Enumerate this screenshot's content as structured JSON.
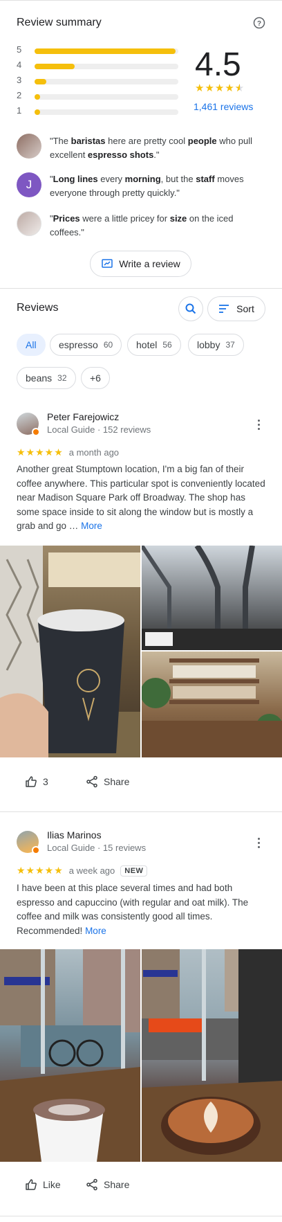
{
  "summary": {
    "title": "Review summary",
    "rating": "4.5",
    "reviews_link": "1,461 reviews",
    "histogram": [
      {
        "star": "5",
        "fraction": 0.98
      },
      {
        "star": "4",
        "fraction": 0.28
      },
      {
        "star": "3",
        "fraction": 0.08
      },
      {
        "star": "2",
        "fraction": 0.03
      },
      {
        "star": "1",
        "fraction": 0.04
      }
    ],
    "stars_filled": 4.5,
    "write_review_label": "Write a review"
  },
  "snippets": [
    {
      "html": "\"The <b>baristas</b> here are pretty cool <b>people</b> who pull excellent <b>espresso shots</b>.\""
    },
    {
      "avatar_letter": "J",
      "html": "\"<b>Long lines</b> every <b>morning</b>, but the <b>staff</b> moves everyone through pretty quickly.\""
    },
    {
      "html": "\"<b>Prices</b> were a little pricey for <b>size</b> on the iced coffees.\""
    }
  ],
  "reviews_section": {
    "title": "Reviews",
    "sort_label": "Sort",
    "chips": [
      {
        "label": "All",
        "count": ""
      },
      {
        "label": "espresso",
        "count": "60"
      },
      {
        "label": "hotel",
        "count": "56"
      },
      {
        "label": "lobby",
        "count": "37"
      },
      {
        "label": "beans",
        "count": "32"
      },
      {
        "label": "+6",
        "count": ""
      }
    ]
  },
  "reviews": [
    {
      "name": "Peter Farejowicz",
      "meta": "Local Guide · 152 reviews",
      "stars": "★★★★★",
      "time": "a month ago",
      "text": "Another great Stumptown location, I'm a big fan of their coffee anywhere. This particular spot is conveniently located near Madison Square Park off Broadway. The shop has some space inside to sit along the window but is mostly a grab and go … ",
      "more": "More",
      "likes": "3",
      "share": "Share"
    },
    {
      "name": "Ilias Marinos",
      "meta": "Local Guide · 15 reviews",
      "stars": "★★★★★",
      "time": "a week ago",
      "badge": "NEW",
      "text": "I have been at this place several times and had both espresso and capuccino (with regular and oat milk). The coffee and milk was consistently good all times. Recommended! ",
      "more": "More",
      "likes": "Like",
      "share": "Share"
    }
  ],
  "colors": {
    "accent": "#1a73e8",
    "star": "#f5bf0c",
    "avatar_j": "#7e57c2"
  }
}
